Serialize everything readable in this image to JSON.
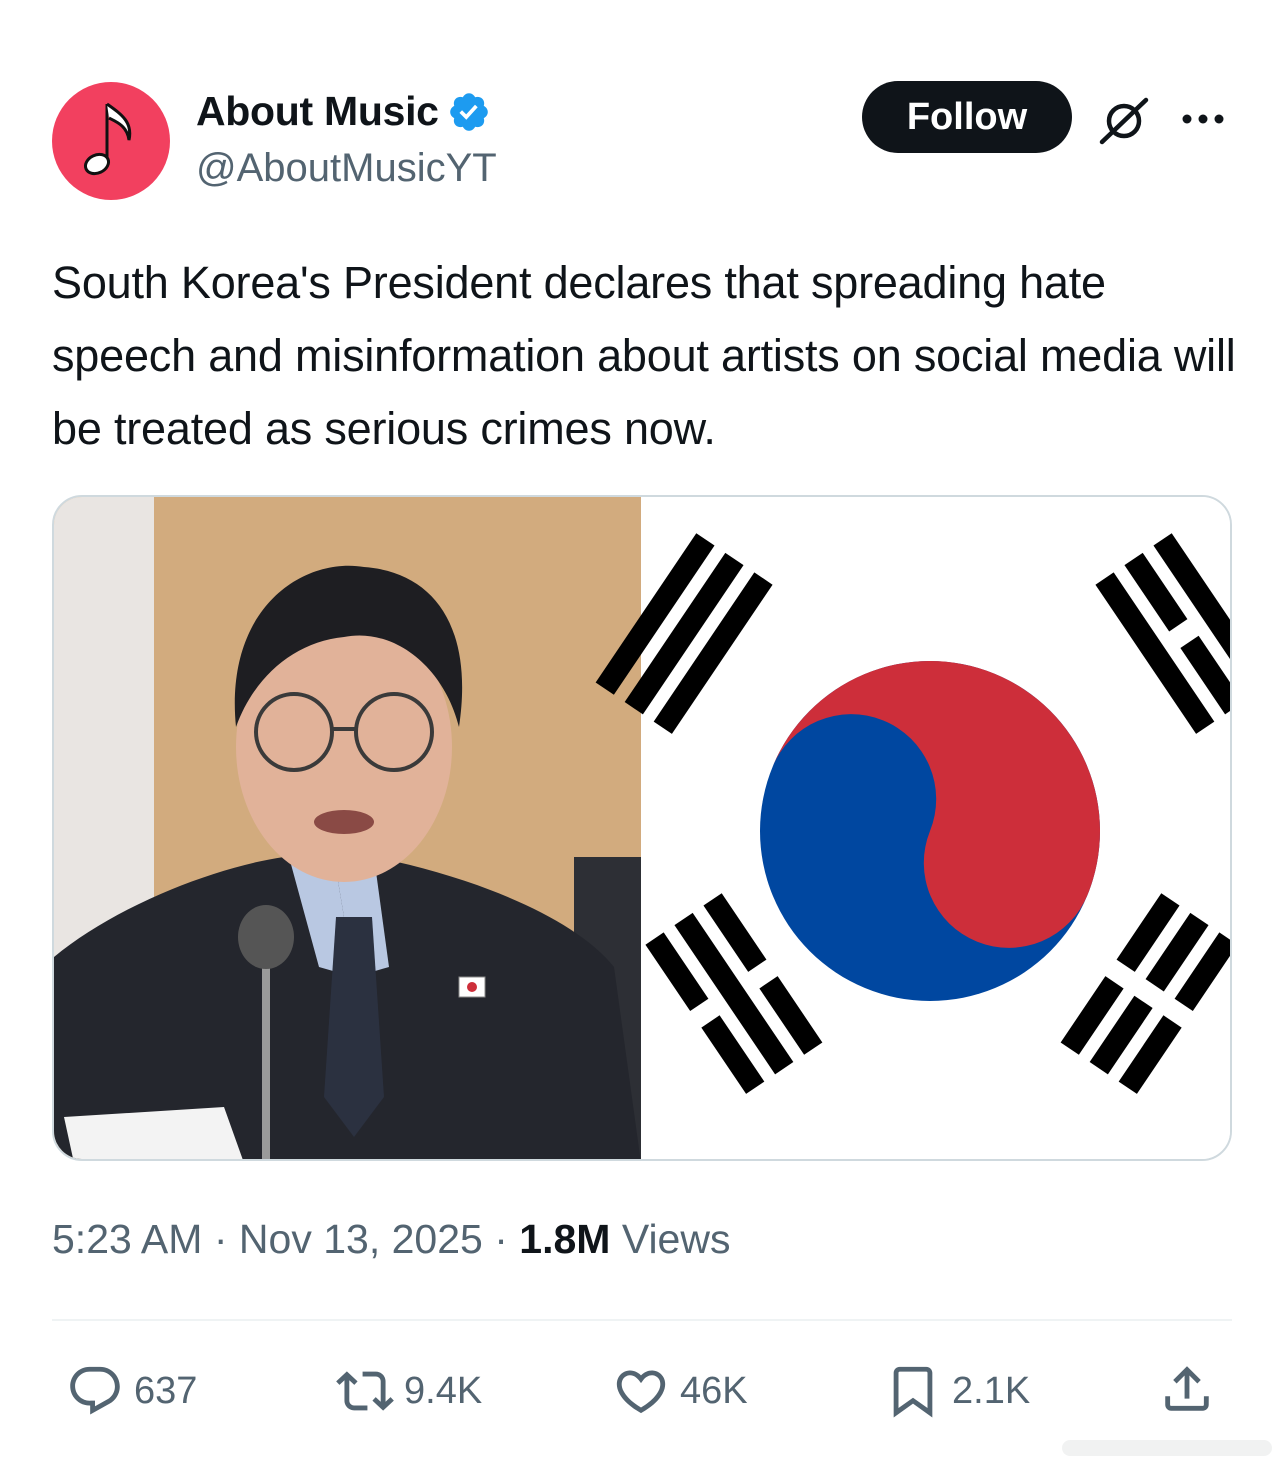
{
  "author": {
    "name": "About Music",
    "handle": "@AboutMusicYT",
    "avatar_icon": "music-note-icon",
    "avatar_color": "#f2405f",
    "verified_color": "#1d9bf0"
  },
  "header": {
    "follow_label": "Follow",
    "grok_icon": "grok-icon",
    "more_icon": "more-dots-icon"
  },
  "tweet": {
    "text": "South Korea's President declares that spreading hate speech and misinformation about artists on social media will be treated as serious crimes now."
  },
  "media": {
    "left_image": "photo-man-speaking-at-microphone",
    "right_image": "south-korea-flag"
  },
  "meta": {
    "time": "5:23 AM",
    "date": "Nov 13, 2025",
    "views_count": "1.8M",
    "views_label": "Views",
    "separator": "·"
  },
  "actions": {
    "replies": "637",
    "reposts": "9.4K",
    "likes": "46K",
    "bookmarks": "2.1K"
  }
}
